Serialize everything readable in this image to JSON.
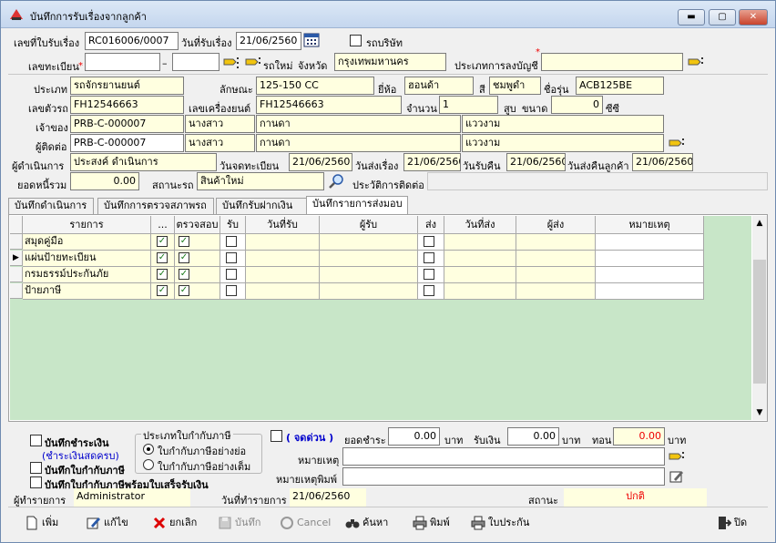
{
  "window": {
    "title": "บันทึกการรับเรื่องจากลูกค้า",
    "min": "▬",
    "max": "▢",
    "close": "✕"
  },
  "row1": {
    "doc_label": "เลขที่ใบรับเรื่อง",
    "doc_value": "RC016006/0007",
    "date_label": "วันที่รับเรื่อง",
    "date_value": "21/06/2560",
    "company_car_label": "รถบริษัท"
  },
  "row2": {
    "reg_label": "เลขทะเบียน",
    "reg_sep": "–",
    "newcar_label": "รถใหม่",
    "province_label": "จังหวัด",
    "province_value": "กรุงเทพมหานคร",
    "account_type_label": "ประเภทการลงบัญชี",
    "account_type_value": ""
  },
  "car": {
    "type_label": "ประเภท",
    "type_value": "รถจักรยานยนต์",
    "model_label": "ลักษณะ",
    "model_value": "125-150 CC",
    "brand_label": "ยี่ห้อ",
    "brand_value": "ฮอนด้า",
    "color_label": "สี",
    "color_value": "ชมพูดำ",
    "submodel_label": "ชื่อรุ่น",
    "submodel_value": "ACB125BE",
    "chassis_label": "เลขตัวรถ",
    "chassis_value": "FH12546663",
    "engine_label": "เลขเครื่องยนต์",
    "engine_value": "FH12546663",
    "qty_label": "จำนวน",
    "qty_value": "1",
    "cyl_label": "สูบ",
    "size_label": "ขนาด",
    "size_value": "0",
    "cc_label": "ซีซี"
  },
  "owner": {
    "label": "เจ้าของ",
    "code": "PRB-C-000007",
    "title": "นางสาว",
    "first": "กานดา",
    "last": "แววงาม"
  },
  "contact": {
    "label": "ผู้ติดต่อ",
    "code": "PRB-C-000007",
    "title": "นางสาว",
    "first": "กานดา",
    "last": "แววงาม"
  },
  "process": {
    "label": "ผู้ดำเนินการ",
    "value": "ประสงค์ ดำเนินการ",
    "reg_date_label": "วันจดทะเบียน",
    "reg_date": "21/06/2560",
    "send_label": "วันส่งเรื่อง",
    "send_date": "21/06/2560",
    "recv_label": "วันรับคืน",
    "recv_date": "21/06/2560",
    "return_label": "วันส่งคืนลูกค้า",
    "return_date": "21/06/2560"
  },
  "debt": {
    "label": "ยอดหนี้รวม",
    "value": "0.00",
    "status_label": "สถานะรถ",
    "status_value": "สินค้าใหม่",
    "history_label": "ประวัติการติดต่อ"
  },
  "tabs": [
    "บันทึกดำเนินการ",
    "บันทึกการตรวจสภาพรถ",
    "บันทึกรับฝากเงิน",
    "บันทึกรายการส่งมอบ"
  ],
  "grid": {
    "headers": [
      "รายการ",
      "...",
      "ตรวจสอบ",
      "รับ",
      "วันที่รับ",
      "ผู้รับ",
      "ส่ง",
      "วันที่ส่ง",
      "ผู้ส่ง",
      "หมายเหตุ"
    ],
    "rows": [
      {
        "item": "สมุดคู่มือ",
        "c1": true,
        "c2": true,
        "recv": false,
        "send": false
      },
      {
        "item": "แผ่นป้ายทะเบียน",
        "c1": true,
        "c2": true,
        "recv": false,
        "send": false
      },
      {
        "item": "กรมธรรม์ประกันภัย",
        "c1": true,
        "c2": true,
        "recv": false,
        "send": false
      },
      {
        "item": "ป้ายภาษี",
        "c1": true,
        "c2": true,
        "recv": false,
        "send": false
      }
    ]
  },
  "footer": {
    "pay_record": "บันทึกชำระเงิน",
    "pay_note": "(ชำระเงินสดครบ)",
    "tax_invoice": "บันทึกใบกำกับภาษี",
    "tax_invoice_receipt": "บันทึกใบกำกับภาษีพร้อมใบเสร็จรับเงิน",
    "group_title": "ประเภทใบกำกับภาษี",
    "radio_short": "ใบกำกับภาษีอย่างย่อ",
    "radio_full": "ใบกำกับภาษีอย่างเต็ม",
    "urgent": "( จดด่วน )",
    "pay_amount_label": "ยอดชำระ",
    "pay_amount": "0.00",
    "baht1": "บาท",
    "recv_label": "รับเงิน",
    "recv_amount": "0.00",
    "baht2": "บาท",
    "change_label": "ทอน",
    "change_amount": "0.00",
    "baht3": "บาท",
    "note_label": "หมายเหตุ",
    "note_print_label": "หมายเหตุพิมพ์",
    "recorder_label": "ผู้ทำรายการ",
    "recorder_value": "Administrator",
    "tx_date_label": "วันที่ทำรายการ",
    "tx_date": "21/06/2560",
    "status_label": "สถานะ",
    "status_value": "ปกติ"
  },
  "toolbar": {
    "add": "เพิ่ม",
    "edit": "แก้ไข",
    "cancel_doc": "ยกเลิก",
    "save": "บันทึก",
    "cancel": "Cancel",
    "search": "ค้นหา",
    "print": "พิมพ์",
    "invoice": "ใบประกัน",
    "close": "ปิด"
  }
}
